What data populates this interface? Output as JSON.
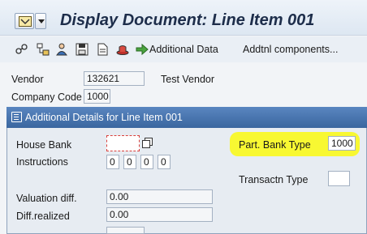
{
  "window": {
    "title": "Display Document: Line Item 001"
  },
  "toolbar": {
    "icons": [
      "glasses-icon",
      "hierarchy-icon",
      "person-icon",
      "save-icon",
      "document-icon",
      "hat-icon",
      "arrow-right-icon"
    ],
    "additional_data_label": "Additional Data",
    "addtnl_components_label": "Addtnl components..."
  },
  "header": {
    "vendor_label": "Vendor",
    "vendor_value": "132621",
    "vendor_name": "Test Vendor",
    "company_code_label": "Company Code",
    "company_code_value": "1000"
  },
  "popup": {
    "title": "Additional Details for Line Item 001",
    "house_bank_label": "House Bank",
    "house_bank_value": "",
    "instructions_label": "Instructions",
    "instructions_values": [
      "0",
      "0",
      "0",
      "0"
    ],
    "part_bank_type_label": "Part. Bank Type",
    "part_bank_type_value": "1000",
    "transactn_type_label": "Transactn Type",
    "transactn_type_value": "",
    "valuation_diff_label": "Valuation diff.",
    "valuation_diff_value": "0.00",
    "diff_realized_label": "Diff.realized",
    "diff_realized_value": "0.00"
  },
  "colors": {
    "popup_header": "#3a669f",
    "highlight": "#f8f832",
    "focus_marker": "#d8413d"
  }
}
